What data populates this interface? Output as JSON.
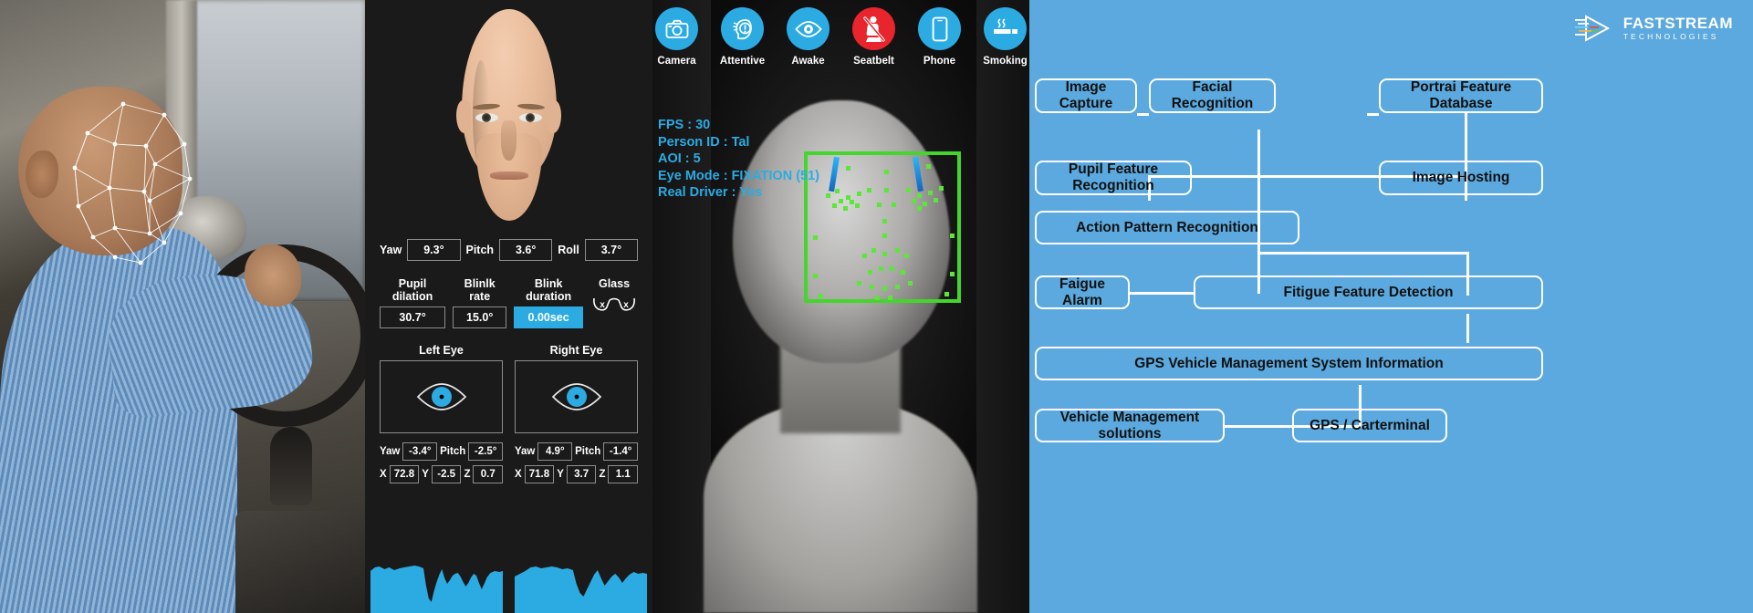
{
  "driver_panel": {
    "name": "driver-camera-feed",
    "overlay": "face-mesh-wireframe"
  },
  "metrics": {
    "head_pose": [
      {
        "label": "Yaw",
        "value": "9.3°"
      },
      {
        "label": "Pitch",
        "value": "3.6°"
      },
      {
        "label": "Roll",
        "value": "3.7°"
      }
    ],
    "stats": [
      {
        "label": "Pupil dilation",
        "value": "30.7°",
        "highlight": false
      },
      {
        "label": "Blinlk rate",
        "value": "15.0°",
        "highlight": false
      },
      {
        "label": "Blink duration",
        "value": "0.00sec",
        "highlight": true
      }
    ],
    "glass": {
      "label": "Glass",
      "left_mark": "x",
      "right_mark": "x"
    },
    "eyes": [
      {
        "title": "Left Eye",
        "yaw_label": "Yaw",
        "yaw": "-3.4°",
        "pitch_label": "Pitch",
        "pitch": "-2.5°",
        "x_label": "X",
        "x": "72.8",
        "y_label": "Y",
        "y": "-2.5",
        "z_label": "Z",
        "z": "0.7"
      },
      {
        "title": "Right Eye",
        "yaw_label": "Yaw",
        "yaw": "4.9°",
        "pitch_label": "Pitch",
        "pitch": "-1.4°",
        "x_label": "X",
        "x": "71.8",
        "y_label": "Y",
        "y": "3.7",
        "z_label": "Z",
        "z": "1.1"
      }
    ],
    "accent_color": "#2cabe3",
    "background_color": "#1a1a1a"
  },
  "ir_panel": {
    "status_icons": [
      {
        "label": "Camera",
        "icon": "camera-icon",
        "state": "ok"
      },
      {
        "label": "Attentive",
        "icon": "attentive-icon",
        "state": "ok"
      },
      {
        "label": "Awake",
        "icon": "awake-eye-icon",
        "state": "ok"
      },
      {
        "label": "Seatbelt",
        "icon": "seatbelt-icon",
        "state": "alert"
      },
      {
        "label": "Phone",
        "icon": "phone-icon",
        "state": "ok"
      },
      {
        "label": "Smoking",
        "icon": "smoking-icon",
        "state": "ok"
      }
    ],
    "telemetry": [
      "FPS : 30",
      "Person ID : Tal",
      "AOI : 5",
      "Eye Mode : FIXATION (51)",
      "Real Driver : Yes"
    ],
    "ok_color": "#2cabe3",
    "alert_color": "#e8242c",
    "tracking_box_color": "#44d62c",
    "landmark_color": "#5ce63a"
  },
  "diagram": {
    "background_color": "#5ba9de",
    "logo": {
      "line1": "FASTSTREAM",
      "line2": "TECHNOLOGIES"
    },
    "nodes": [
      {
        "id": "image-capture",
        "label": "Image Capture"
      },
      {
        "id": "facial-recognition",
        "label": "Facial Recognition"
      },
      {
        "id": "portrait-db",
        "label": "Portrai Feature Database"
      },
      {
        "id": "pupil-feature",
        "label": "Pupil Feature Recognition"
      },
      {
        "id": "image-hosting",
        "label": "Image Hosting"
      },
      {
        "id": "action-pattern",
        "label": "Action Pattern Recognition"
      },
      {
        "id": "fatigue-alarm",
        "label": "Faigue Alarm"
      },
      {
        "id": "fatigue-detection",
        "label": "Fitigue Feature Detection"
      },
      {
        "id": "gps-vms-info",
        "label": "GPS Vehicle Management System Information"
      },
      {
        "id": "vehicle-mgmt",
        "label": "Vehicle Management solutions"
      },
      {
        "id": "gps-carterminal",
        "label": "GPS / Carterminal"
      }
    ]
  }
}
